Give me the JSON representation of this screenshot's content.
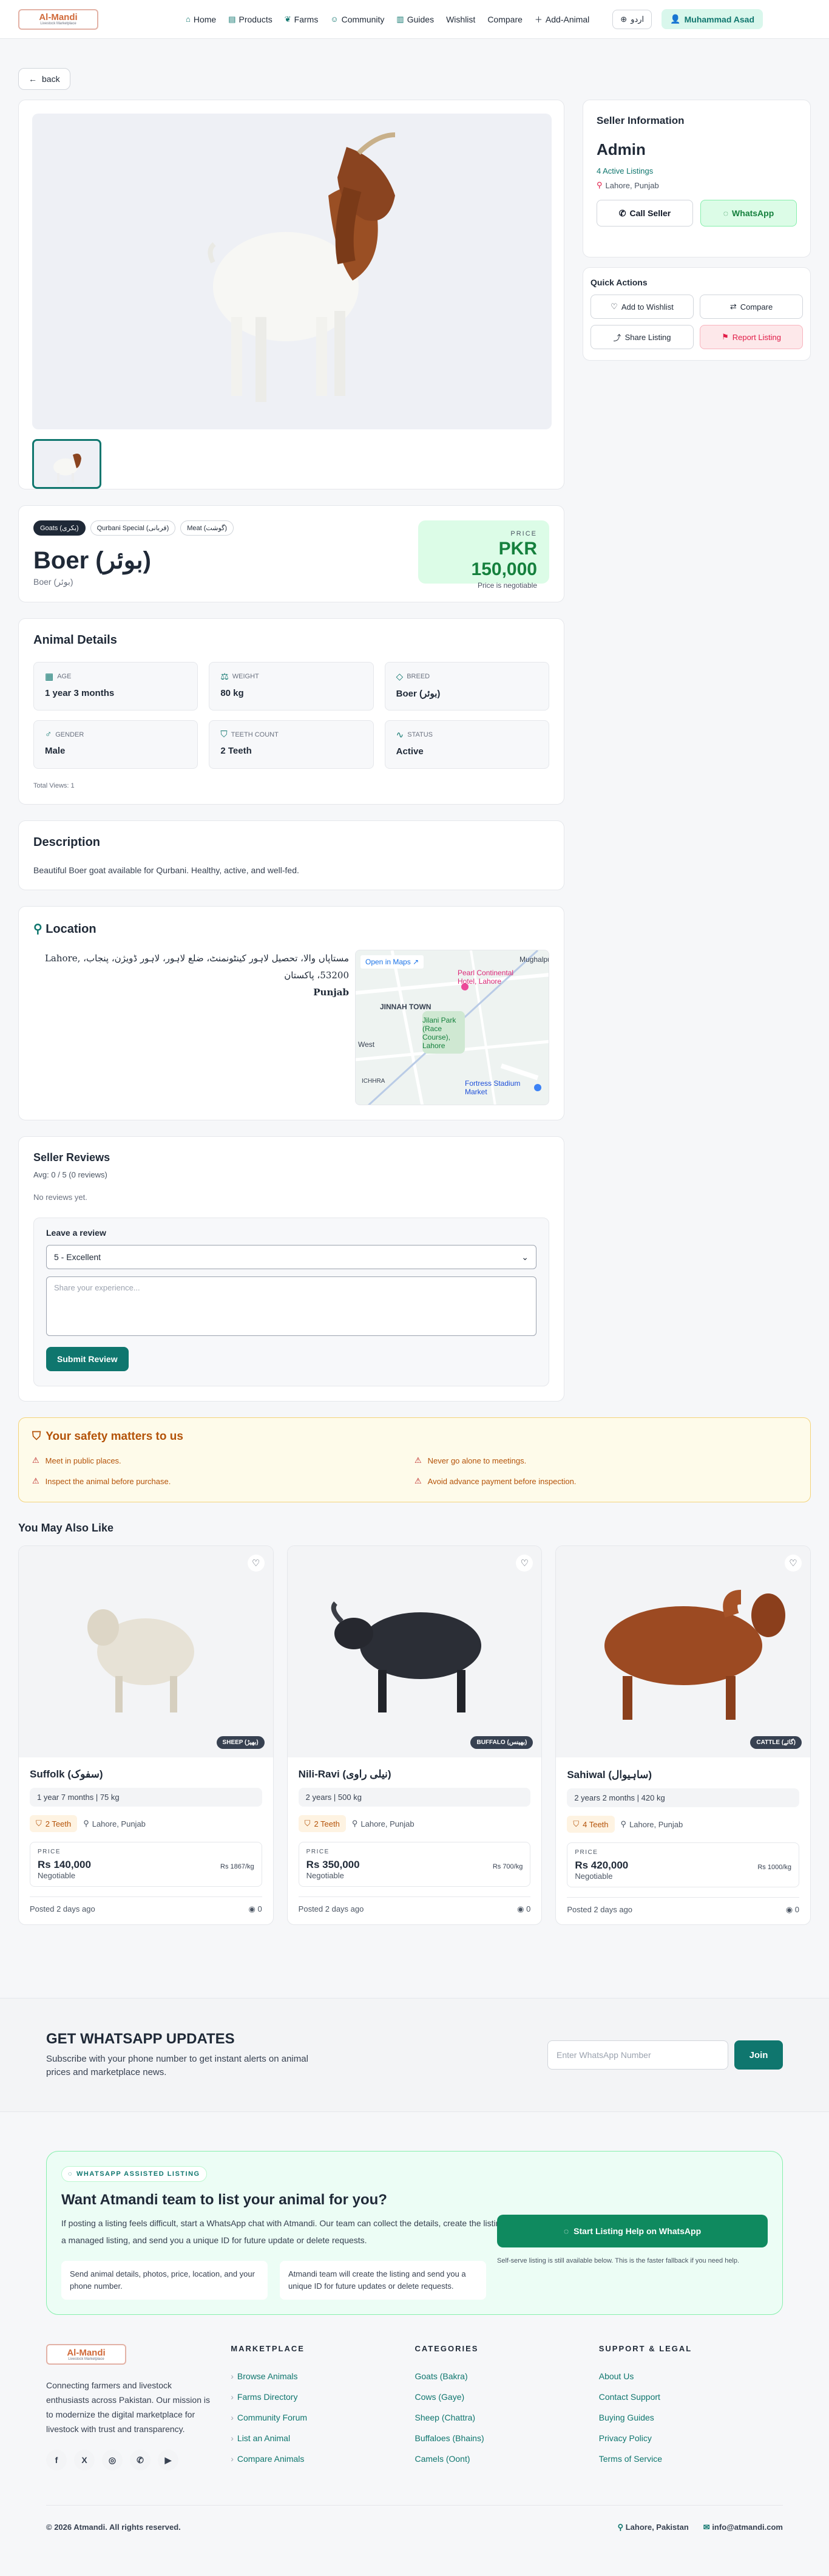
{
  "header": {
    "logo_title": "Al-Mandi",
    "logo_tagline": "Livestock Marketplace",
    "nav": [
      {
        "label": "Home",
        "icon": "home-icon"
      },
      {
        "label": "Products",
        "icon": "products-icon"
      },
      {
        "label": "Farms",
        "icon": "farms-icon"
      },
      {
        "label": "Community",
        "icon": "community-icon"
      },
      {
        "label": "Guides",
        "icon": "book-icon"
      },
      {
        "label": "Wishlist",
        "icon": ""
      },
      {
        "label": "Compare",
        "icon": ""
      },
      {
        "label": "Add-Animal",
        "icon": "plus-icon"
      }
    ],
    "language": "اردو",
    "user": "Muhammad Asad"
  },
  "back_label": "back",
  "seller": {
    "heading": "Seller Information",
    "name": "Admin",
    "listings": "4 Active Listings",
    "location": "Lahore, Punjab",
    "call_label": "Call Seller",
    "whatsapp_label": "WhatsApp"
  },
  "quick_actions": {
    "heading": "Quick Actions",
    "wishlist": "Add to Wishlist",
    "compare": "Compare",
    "share": "Share Listing",
    "report": "Report Listing"
  },
  "listing": {
    "tags": [
      "Goats (بکری)",
      "Qurbani Special (قربانی)",
      "Meat (گوشت)"
    ],
    "title": "Boer (بوئر)",
    "subtitle": "Boer (بوئر)",
    "price_label": "PRICE",
    "price": "PKR 150,000",
    "price_note": "Price is negotiable"
  },
  "details": {
    "heading": "Animal Details",
    "items": [
      {
        "label": "AGE",
        "value": "1 year 3 months"
      },
      {
        "label": "WEIGHT",
        "value": "80 kg"
      },
      {
        "label": "BREED",
        "value": "Boer (بوئر)"
      },
      {
        "label": "GENDER",
        "value": "Male"
      },
      {
        "label": "TEETH COUNT",
        "value": "2 Teeth"
      },
      {
        "label": "STATUS",
        "value": "Active"
      }
    ],
    "total_views": "Total Views: 1"
  },
  "description": {
    "heading": "Description",
    "text": "Beautiful Boer goat available for Qurbani. Healthy, active, and well-fed."
  },
  "location": {
    "heading": "Location",
    "address_line1": "Lahore, مستاپاں والا، تحصیل لاہور کینٹونمنٹ، ضلع لاہور، لاہور ڈویژن، پنجاب، 53200، پاکستان",
    "address_line2": "Punjab",
    "open_maps": "Open in Maps",
    "map_labels": {
      "jinnah": "JINNAH TOWN",
      "park": "Jilani Park (Race Course), Lahore",
      "hotel": "Pearl Continental Hotel, Lahore",
      "stadium": "Fortress Stadium Market",
      "mughal": "Mughalpu",
      "west": "West",
      "ichhra": "ICHHRA"
    }
  },
  "reviews": {
    "heading": "Seller Reviews",
    "avg": "Avg: 0 / 5 (0 reviews)",
    "none": "No reviews yet.",
    "leave": "Leave a review",
    "select_value": "5 - Excellent",
    "placeholder": "Share your experience...",
    "submit": "Submit Review"
  },
  "safety": {
    "heading": "Your safety matters to us",
    "items": [
      "Meet in public places.",
      "Never go alone to meetings.",
      "Inspect the animal before purchase.",
      "Avoid advance payment before inspection."
    ]
  },
  "also_like": {
    "heading": "You May Also Like",
    "cards": [
      {
        "name": "Suffolk (سفوک)",
        "badge": "SHEEP (بھیڑ)",
        "meta": "1 year 7 months | 75 kg",
        "teeth": "2 Teeth",
        "location": "Lahore, Punjab",
        "price_label": "PRICE",
        "price": "Rs 140,000",
        "negotiable": "Negotiable",
        "per_kg": "Rs 1867/kg",
        "posted": "Posted 2 days ago",
        "views": "0"
      },
      {
        "name": "Nili-Ravi (نیلی راوی)",
        "badge": "BUFFALO (بھینس)",
        "meta": "2 years | 500 kg",
        "teeth": "2 Teeth",
        "location": "Lahore, Punjab",
        "price_label": "PRICE",
        "price": "Rs 350,000",
        "negotiable": "Negotiable",
        "per_kg": "Rs 700/kg",
        "posted": "Posted 2 days ago",
        "views": "0"
      },
      {
        "name": "Sahiwal (ساہیوال)",
        "badge": "CATTLE (گائے)",
        "meta": "2 years 2 months | 420 kg",
        "teeth": "4 Teeth",
        "location": "Lahore, Punjab",
        "price_label": "PRICE",
        "price": "Rs 420,000",
        "negotiable": "Negotiable",
        "per_kg": "Rs 1000/kg",
        "posted": "Posted 2 days ago",
        "views": "0"
      }
    ]
  },
  "wa_updates": {
    "heading": "GET WHATSAPP UPDATES",
    "text": "Subscribe with your phone number to get instant alerts on animal prices and marketplace news.",
    "placeholder": "Enter WhatsApp Number",
    "join": "Join"
  },
  "assist": {
    "pill": "WHATSAPP ASSISTED LISTING",
    "heading": "Want Atmandi team to list your animal for you?",
    "text": "If posting a listing feels difficult, start a WhatsApp chat with Atmandi. Our team can collect the details, create the listing as a managed listing, and send you a unique ID for future update or delete requests.",
    "box1": "Send animal details, photos, price, location, and your phone number.",
    "box2": "Atmandi team will create the listing and send you a unique ID for future updates or delete requests.",
    "button": "Start Listing Help on WhatsApp",
    "note": "Self-serve listing is still available below. This is the faster fallback if you need help."
  },
  "footer": {
    "about": "Connecting farmers and livestock enthusiasts across Pakistan. Our mission is to modernize the digital marketplace for livestock with trust and transparency.",
    "social": [
      "f",
      "X",
      "◎",
      "✆",
      "▶"
    ],
    "cols": [
      {
        "heading": "MARKETPLACE",
        "links": [
          "Browse Animals",
          "Farms Directory",
          "Community Forum",
          "List an Animal",
          "Compare Animals"
        ]
      },
      {
        "heading": "CATEGORIES",
        "links": [
          "Goats (Bakra)",
          "Cows (Gaye)",
          "Sheep (Chattra)",
          "Buffaloes (Bhains)",
          "Camels (Oont)"
        ]
      },
      {
        "heading": "SUPPORT & LEGAL",
        "links": [
          "About Us",
          "Contact Support",
          "Buying Guides",
          "Privacy Policy",
          "Terms of Service"
        ]
      }
    ],
    "copyright": "© 2026 Atmandi. All rights reserved.",
    "location": "Lahore, Pakistan",
    "email": "info@atmandi.com"
  }
}
